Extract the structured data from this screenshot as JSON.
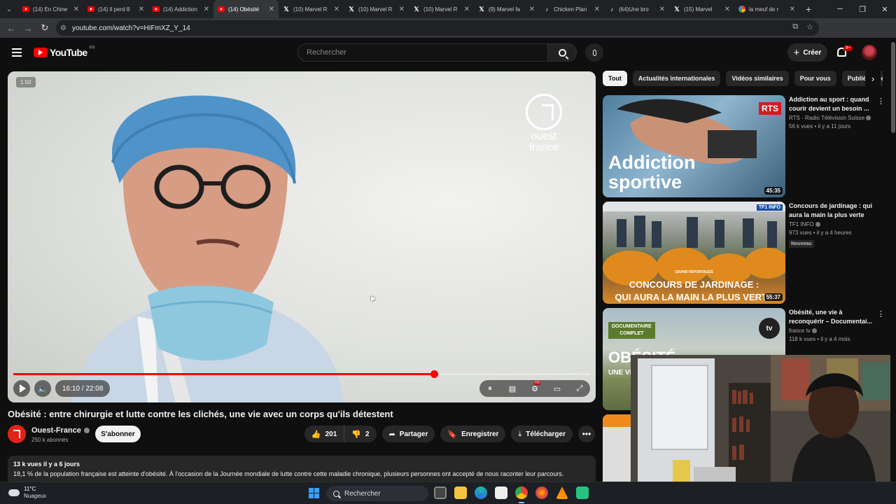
{
  "browser": {
    "tabs": [
      {
        "label": "(14) En Chine",
        "icon": "youtube-icon",
        "kind": "yt"
      },
      {
        "label": "(14) Il perd 8",
        "icon": "youtube-icon",
        "kind": "yt"
      },
      {
        "label": "(14) Addiction",
        "icon": "youtube-icon",
        "kind": "yt"
      },
      {
        "label": "(14) Obésité",
        "icon": "youtube-icon",
        "kind": "yt",
        "active": true
      },
      {
        "label": "(10) Marvel R",
        "icon": "x-icon",
        "kind": "x"
      },
      {
        "label": "(10) Marvel R",
        "icon": "x-icon",
        "kind": "x"
      },
      {
        "label": "(10) Marvel R",
        "icon": "x-icon",
        "kind": "x"
      },
      {
        "label": "(9) Marvel fa",
        "icon": "x-icon",
        "kind": "x"
      },
      {
        "label": "Chicken Plan",
        "icon": "tiktok-icon",
        "kind": "tt"
      },
      {
        "label": "(64)Une bro",
        "icon": "tiktok-icon",
        "kind": "tt"
      },
      {
        "label": "(15) Marvel",
        "icon": "x-icon",
        "kind": "x"
      },
      {
        "label": "la meuf de r",
        "icon": "google-icon",
        "kind": "gg"
      }
    ],
    "tab_close": "✕",
    "new_tab": "+",
    "url": "youtube.com/watch?v=HIFmXZ_Y_14",
    "window_controls": {
      "minimize": "─",
      "maximize": "❐",
      "close": "✕"
    }
  },
  "header": {
    "logo_text": "YouTube",
    "country_code": "FR",
    "search_placeholder": "Rechercher",
    "create_label": "Créer",
    "create_plus": "+",
    "notification_count": "9+"
  },
  "player": {
    "speed": "1.50",
    "logo_text": [
      "ouest",
      "france"
    ],
    "time": "16:10 / 22:08",
    "progress": 0.7289
  },
  "video": {
    "title": "Obésité : entre chirurgie et lutte contre les clichés, une vie avec un corps qu'ils détestent",
    "channel_name": "Ouest-France",
    "subscribers": "250 k abonnés",
    "subscribe_label": "S'abonner",
    "likes": "201",
    "dislikes": "2",
    "share_label": "Partager",
    "save_label": "Enregistrer",
    "download_label": "Télécharger",
    "more_label": "•••",
    "description": {
      "meta": "13 k vues  il y a 6 jours",
      "text": "18,1 % de la population française est atteinte d'obésité. À l'occasion de la Journée mondiale de lutte contre cette maladie chronique, plusieurs personnes ont accepté de nous raconter leur parcours."
    }
  },
  "chips": [
    {
      "label": "Tout",
      "active": true
    },
    {
      "label": "Actualités internationales"
    },
    {
      "label": "Vidéos similaires"
    },
    {
      "label": "Pour vous"
    },
    {
      "label": "Publiées récemment"
    }
  ],
  "recommendations": [
    {
      "title": "Addiction au sport : quand courir devient un besoin ...",
      "channel": "RTS - Radio Télévision Suisse",
      "meta": "56 k vues • il y a 11 jours",
      "duration": "45:35",
      "thumb_badge": "RTS",
      "thumb_text": [
        "Addiction",
        "sportive"
      ]
    },
    {
      "title": "Concours de jardinage : qui aura la main la plus verte ?...",
      "channel": "TF1 INFO",
      "meta": "973 vues • il y a 4 heures",
      "badge": "Nouveau",
      "duration": "55:37",
      "thumb_badge": "TF1 INFO",
      "thumb_small": "GRAND REPORTAGES",
      "thumb_text": [
        "CONCOURS DE JARDINAGE :",
        "QUI AURA LA MAIN LA PLUS VERTE"
      ]
    },
    {
      "title": "Obésité, une vie à reconquérir – Documentai...",
      "channel": "france tv",
      "meta": "118 k vues • il y a 4 mois",
      "thumb_badge": "tv",
      "thumb_label": [
        "DOCUMENTAIRE",
        "COMPLET"
      ],
      "thumb_text": [
        "OBÉSITÉ",
        "UNE VIE"
      ]
    }
  ],
  "taskbar": {
    "weather_temp": "11°C",
    "weather_desc": "Nuageux",
    "search_label": "Rechercher"
  },
  "colors": {
    "accent": "#ff0000",
    "page_bg": "#0f0f0f",
    "chip_bg": "#272727"
  }
}
